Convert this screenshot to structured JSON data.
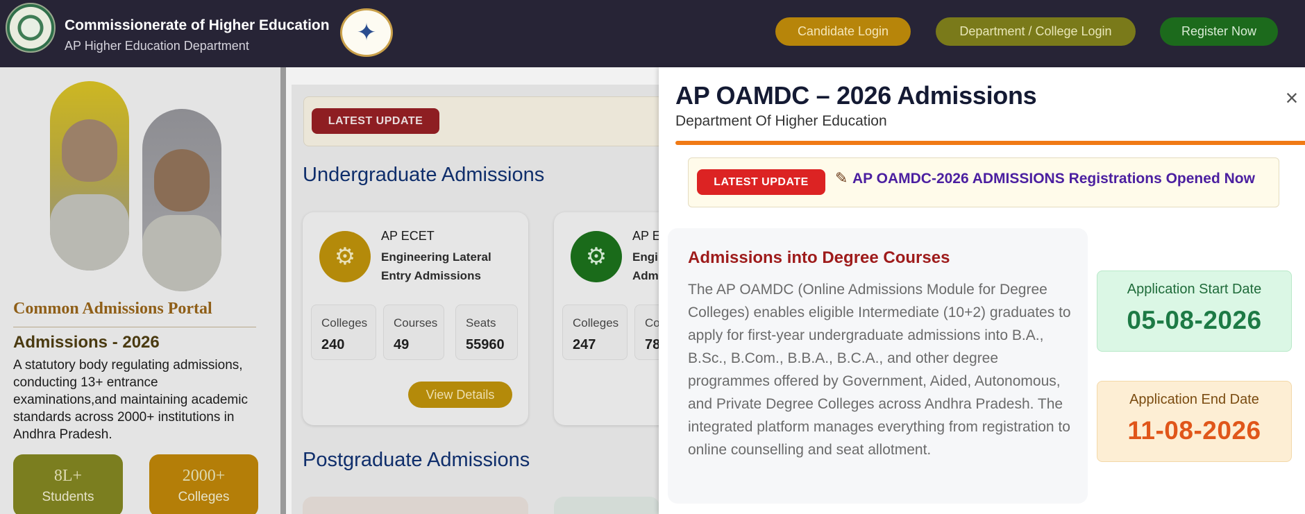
{
  "header": {
    "title": "Commissionerate of Higher Education",
    "subtitle": "AP Higher Education Department",
    "candidate_login": "Candidate Login",
    "dept_login": "Department / College Login",
    "register": "Register Now"
  },
  "left": {
    "portal_title": "Common Admissions Portal",
    "admissions_title": "Admissions - 2026",
    "description": "A statutory body regulating admissions, conducting 13+ entrance examinations,and maintaining academic standards across 2000+ institutions in Andhra Pradesh.",
    "stats": [
      {
        "value": "8L+",
        "label": "Students"
      },
      {
        "value": "2000+",
        "label": "Colleges"
      }
    ]
  },
  "main": {
    "latest_update_badge": "LATEST UPDATE",
    "ug_title": "Undergraduate Admissions",
    "pg_title": "Postgraduate Admissions",
    "cards": [
      {
        "name": "AP ECET",
        "subtitle": "Engineering Lateral Entry Admissions",
        "stats": [
          {
            "label": "Colleges",
            "value": "240"
          },
          {
            "label": "Courses",
            "value": "49"
          },
          {
            "label": "Seats",
            "value": "55960"
          }
        ],
        "button": "View Details"
      },
      {
        "name": "AP E",
        "subtitle_line1": "Engi",
        "subtitle_line2": "Adm",
        "stats": [
          {
            "label": "Colleges",
            "value": "247"
          },
          {
            "label": "Co",
            "value": "78"
          }
        ]
      }
    ]
  },
  "modal": {
    "title": "AP OAMDC – 2026 Admissions",
    "subtitle": "Department Of Higher Education",
    "close_glyph": "×",
    "latest_update_badge": "LATEST UPDATE",
    "ticker_text": "AP OAMDC-2026 ADMISSIONS Registrations Opened Now",
    "info_title": "Admissions into Degree Courses",
    "info_description": "The AP OAMDC (Online Admissions Module for Degree Colleges) enables eligible Intermediate (10+2) graduates to apply for first-year undergraduate admissions into B.A., B.Sc., B.Com., B.B.A., B.C.A., and other degree programmes offered by Government, Aided, Autonomous, and Private Degree Colleges across Andhra Pradesh. The integrated platform manages everything from registration to online counselling and seat allotment.",
    "start_label": "Application Start Date",
    "start_date": "05-08-2026",
    "end_label": "Application End Date",
    "end_date": "11-08-2026"
  },
  "icons": {
    "close": "close-icon",
    "pin": "pin-icon",
    "card1": "engineer-icon",
    "card2": "gear-chip-icon"
  },
  "colors": {
    "header_bg": "#272436",
    "accent_orange": "#f07a15",
    "badge_red": "#dc2323",
    "ticker_purple": "#4b1fa0",
    "start_green": "#1d7a45",
    "end_orange": "#e0561a"
  }
}
